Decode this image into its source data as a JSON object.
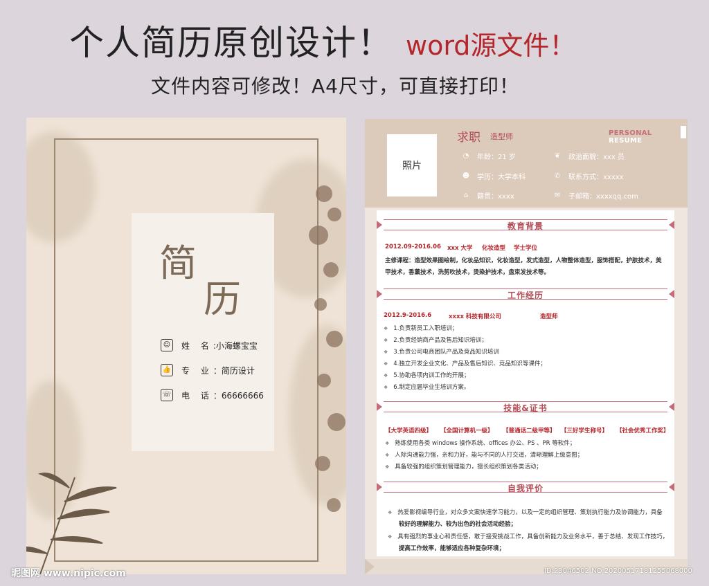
{
  "headline": {
    "main": "个人简历原创设计！",
    "accent": "word源文件！"
  },
  "subhead": "文件内容可修改！A4尺寸，可直接打印！",
  "cover": {
    "title_1": "简",
    "title_2": "历",
    "info": [
      {
        "icon": "person-icon",
        "label": "姓  名",
        "value": ":小海螺宝宝"
      },
      {
        "icon": "thumbs-up-icon",
        "label": "专  业",
        "value": "：简历设计"
      },
      {
        "icon": "phone-icon",
        "label": "电  话",
        "value": "：66666666"
      }
    ]
  },
  "resume": {
    "photo_label": "照片",
    "job_label": "求职",
    "job_title": "造型师",
    "personal_1": "PERSONAL",
    "personal_2": "RESUME",
    "info": {
      "age": "年龄：21 岁",
      "politics": "政治面貌：xxx 员",
      "education": "学历：大学本科",
      "contact": "联系方式：xxxxx",
      "hometown": "籍贯：xxxx",
      "email": "子邮箱：xxxxqq.com"
    },
    "sections": {
      "education": "教育背景",
      "work": "工作经历",
      "skills": "技能&证书",
      "evaluation": "自我评价"
    },
    "education": {
      "period": "2012.09-2016.06",
      "school": "xxx 大学",
      "major": "化妆造型",
      "degree": "学士学位",
      "courses_1": "主修课程：造型效果图绘制，化妆品知识，化妆造型，发式造型，人物整体造型，服饰搭配，护肤技术，美",
      "courses_2": "甲技术，香薰技术，洗剪吹技术，烫染护技术，盘束发技术等。"
    },
    "work": {
      "period": "2012.9-2016.6",
      "company": "xxxx 科技有限公司",
      "position": "造型师",
      "items": [
        "1.负责新员工入职培训；",
        "2.负责经销商产品及售后知识培训；",
        "3.负责公司电商团队产品及竞品知识培训",
        "4.独立开发企业文化、产品及售后知识、竞品知识等课件；",
        "5.协助各项内训工作的开展；",
        "6.制定应届毕业生培训方案。"
      ]
    },
    "skills": {
      "certs": [
        "【大学英语四级】",
        "【全国计算机一级】",
        "【普通话二级甲等】",
        "【三好学生称号】",
        "【社会优秀工作奖】"
      ],
      "items": [
        "熟练使用各类 windows 操作系统、offices 办公、PS 、PR 等软件；",
        "人际沟通能力强，亲和力好，能与不同的人打交道，清晰理解上级意图；",
        "具备较强的组织策划管理能力，擅长组织策划各类活动；"
      ]
    },
    "evaluation": {
      "line_1": "热爱影视编导行业，对众多文案快速学习能力，以及一定的组织管理、策划执行能力及协调能力，具备",
      "line_2": "较好的理解能力、较为出色的社会活动经验；",
      "line_3": "具有强烈的事业心和责任感，敢于接受挑战工作，具备创新能力及业务水平，善于总结、发现工作技巧，",
      "line_4": "提高工作效率，能够适应各种复杂环境；"
    }
  },
  "watermark_left": "昵图网 www.nipic.com",
  "watermark_right": "ID:23046502 NO:20200517181255068000",
  "colors": {
    "accent_red": "#b3262b",
    "section_pink": "#c36b78",
    "cover_bg": "#eee3d6",
    "header_tan": "#dccabb"
  }
}
